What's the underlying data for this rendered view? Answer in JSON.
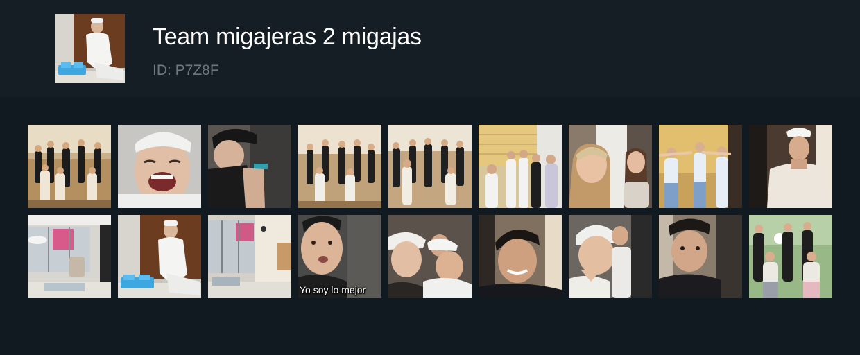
{
  "header": {
    "title": "Team migajeras 2 migajas",
    "subtitle": "ID: P7Z8F",
    "avatar_icon": "profile-photo"
  },
  "videos": [
    {
      "scene": "group-dance",
      "caption": ""
    },
    {
      "scene": "laughing-closeup",
      "caption": ""
    },
    {
      "scene": "person-in-cap",
      "caption": ""
    },
    {
      "scene": "group-dance",
      "caption": ""
    },
    {
      "scene": "group-dance",
      "caption": ""
    },
    {
      "scene": "group-indoor",
      "caption": ""
    },
    {
      "scene": "two-girls",
      "caption": ""
    },
    {
      "scene": "group-pose",
      "caption": ""
    },
    {
      "scene": "man-white-shirt",
      "caption": ""
    },
    {
      "scene": "interior-room",
      "caption": ""
    },
    {
      "scene": "seated-man",
      "caption": ""
    },
    {
      "scene": "interior-room",
      "caption": ""
    },
    {
      "scene": "face-closeup",
      "caption": "Yo soy lo mejor"
    },
    {
      "scene": "selfie-group",
      "caption": ""
    },
    {
      "scene": "face-closeup",
      "caption": ""
    },
    {
      "scene": "selfie-group",
      "caption": ""
    },
    {
      "scene": "face-closeup",
      "caption": ""
    },
    {
      "scene": "group-dance-green",
      "caption": ""
    }
  ],
  "colors": {
    "background": "#111a21",
    "header": "#151d25",
    "title": "#ffffff",
    "subtitle": "#6e7780"
  }
}
